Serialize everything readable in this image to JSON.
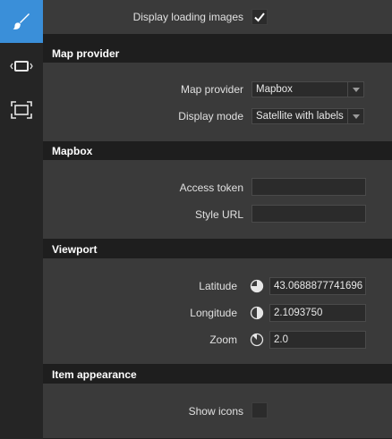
{
  "sidebar": {
    "items": [
      {
        "icon": "paintbrush-icon",
        "active": true
      },
      {
        "icon": "resize-horizontal-icon",
        "active": false
      },
      {
        "icon": "fullscreen-icon",
        "active": false
      }
    ]
  },
  "general": {
    "display_loading_images_label": "Display loading images",
    "display_loading_images_checked": true
  },
  "map_provider": {
    "header": "Map provider",
    "provider_label": "Map provider",
    "provider_value": "Mapbox",
    "mode_label": "Display mode",
    "mode_value": "Satellite with labels"
  },
  "mapbox": {
    "header": "Mapbox",
    "access_token_label": "Access token",
    "access_token_value": "",
    "style_url_label": "Style URL",
    "style_url_value": ""
  },
  "viewport": {
    "header": "Viewport",
    "latitude_label": "Latitude",
    "latitude_value": "43.0688877741696",
    "longitude_label": "Longitude",
    "longitude_value": "2.1093750",
    "zoom_label": "Zoom",
    "zoom_value": "2.0"
  },
  "item_appearance": {
    "header": "Item appearance",
    "show_icons_label": "Show icons",
    "show_icons_checked": false
  },
  "colors": {
    "accent": "#3a8fd9",
    "panel": "#3a3a3a",
    "header_bg": "#1e1e1e"
  }
}
